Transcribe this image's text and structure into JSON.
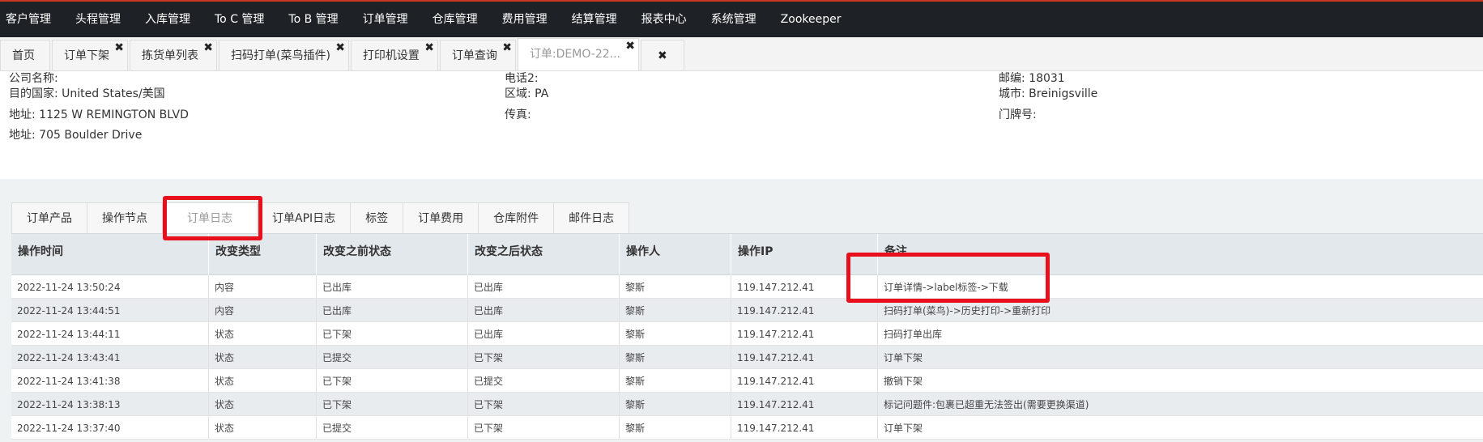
{
  "nav": [
    "客户管理",
    "头程管理",
    "入库管理",
    "To C 管理",
    "To B 管理",
    "订单管理",
    "仓库管理",
    "费用管理",
    "结算管理",
    "报表中心",
    "系统管理",
    "Zookeeper"
  ],
  "tabs": [
    {
      "label": "首页",
      "closable": false
    },
    {
      "label": "订单下架",
      "closable": true
    },
    {
      "label": "拣货单列表",
      "closable": true
    },
    {
      "label": "扫码打单(菜鸟插件)",
      "closable": true
    },
    {
      "label": "打印机设置",
      "closable": true
    },
    {
      "label": "订单查询",
      "closable": true
    },
    {
      "label": "订单:DEMO-22...",
      "closable": true,
      "active": true
    }
  ],
  "close_all_icon": "✖",
  "close_icon": "✖",
  "info": {
    "company": "公司名称:",
    "country": "目的国家: United States/美国",
    "address1": "地址: 1125 W REMINGTON BLVD",
    "address2": "地址: 705 Boulder Drive",
    "phone2": "电话2:",
    "region": "区域: PA",
    "fax": "传真:",
    "zip": "邮编: 18031",
    "city": "城市: Breinigsville",
    "door": "门牌号:"
  },
  "subtabs": [
    "订单产品",
    "操作节点",
    "订单日志",
    "订单API日志",
    "标签",
    "订单费用",
    "仓库附件",
    "邮件日志"
  ],
  "active_subtab": 2,
  "table": {
    "headers": [
      "操作时间",
      "改变类型",
      "改变之前状态",
      "改变之后状态",
      "操作人",
      "操作IP",
      "备注"
    ],
    "rows": [
      [
        "2022-11-24 13:50:24",
        "内容",
        "已出库",
        "已出库",
        "黎斯",
        "119.147.212.41",
        "订单详情->label标签->下载"
      ],
      [
        "2022-11-24 13:44:51",
        "内容",
        "已出库",
        "已出库",
        "黎斯",
        "119.147.212.41",
        "扫码打单(菜鸟)->历史打印->重新打印"
      ],
      [
        "2022-11-24 13:44:11",
        "状态",
        "已下架",
        "已出库",
        "黎斯",
        "119.147.212.41",
        "扫码打单出库"
      ],
      [
        "2022-11-24 13:43:41",
        "状态",
        "已提交",
        "已下架",
        "黎斯",
        "119.147.212.41",
        "订单下架"
      ],
      [
        "2022-11-24 13:41:38",
        "状态",
        "已下架",
        "已提交",
        "黎斯",
        "119.147.212.41",
        "撤销下架"
      ],
      [
        "2022-11-24 13:38:13",
        "状态",
        "已下架",
        "已下架",
        "黎斯",
        "119.147.212.41",
        "标记问题件:包裹已超重无法签出(需要更换渠道)"
      ],
      [
        "2022-11-24 13:37:40",
        "状态",
        "已提交",
        "已下架",
        "黎斯",
        "119.147.212.41",
        "订单下架"
      ]
    ]
  },
  "colors": {
    "nav_bg": "#1e2226",
    "nav_accent": "#c9361f",
    "highlight": "#e8101c"
  }
}
